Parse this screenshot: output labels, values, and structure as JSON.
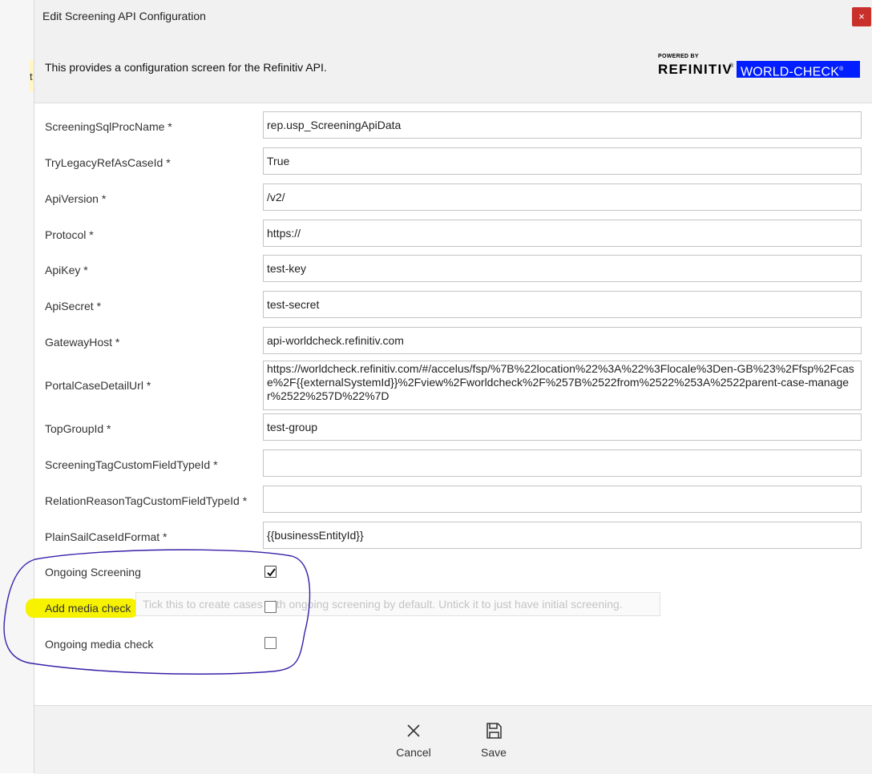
{
  "dialog": {
    "title": "Edit Screening API Configuration",
    "close_symbol": "×",
    "description": "This provides a configuration screen for the Refinitiv API."
  },
  "logo": {
    "powered_by": "POWERED BY",
    "refinitiv": "REFINITIV",
    "registered": "®",
    "world_check": "WORLD-CHECK",
    "world_check_reg": "®"
  },
  "background": {
    "partial_text": "t"
  },
  "fields": [
    {
      "label": "ScreeningSqlProcName *",
      "value": "rep.usp_ScreeningApiData"
    },
    {
      "label": "TryLegacyRefAsCaseId *",
      "value": "True"
    },
    {
      "label": "ApiVersion *",
      "value": "/v2/"
    },
    {
      "label": "Protocol *",
      "value": "https://"
    },
    {
      "label": "ApiKey *",
      "value": "test-key"
    },
    {
      "label": "ApiSecret *",
      "value": "test-secret"
    },
    {
      "label": "GatewayHost *",
      "value": "api-worldcheck.refinitiv.com"
    },
    {
      "label": "PortalCaseDetailUrl *",
      "value": "https://worldcheck.refinitiv.com/#/accelus/fsp/%7B%22location%22%3A%22%3Flocale%3Den-GB%23%2Ffsp%2Fcase%2F{{externalSystemId}}%2Fview%2Fworldcheck%2F%257B%2522from%2522%253A%2522parent-case-manager%2522%257D%22%7D"
    },
    {
      "label": "TopGroupId *",
      "value": "test-group"
    },
    {
      "label": "ScreeningTagCustomFieldTypeId *",
      "value": ""
    },
    {
      "label": "RelationReasonTagCustomFieldTypeId *",
      "value": ""
    },
    {
      "label": "PlainSailCaseIdFormat *",
      "value": "{{businessEntityId}}"
    }
  ],
  "checkboxes": [
    {
      "label": "Ongoing Screening",
      "checked": true
    },
    {
      "label": "Add media check",
      "checked": false
    },
    {
      "label": "Ongoing media check",
      "checked": false
    }
  ],
  "tooltip": "Tick this to create cases with ongoing screening by default. Untick it to just have initial screening.",
  "footer": {
    "cancel_label": "Cancel",
    "save_label": "Save"
  },
  "colors": {
    "close_button": "#c9302c",
    "world_check_blue": "#001eff",
    "highlighter": "#f6f200",
    "annotation_circle": "#3a1fa8"
  },
  "icons": {
    "close": "close-icon",
    "cancel": "x-icon",
    "save": "floppy-disk-icon",
    "check": "checkmark-icon"
  }
}
